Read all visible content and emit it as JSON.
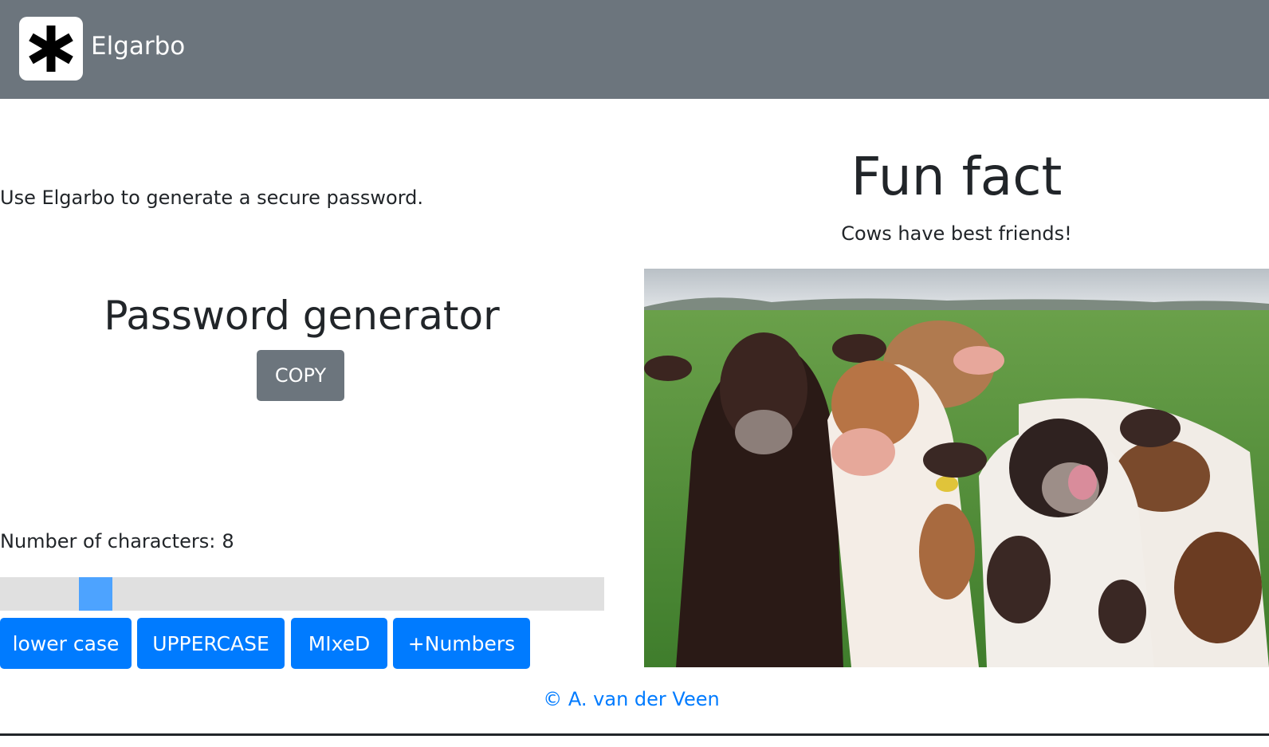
{
  "navbar": {
    "brand": "Elgarbo",
    "logo_icon": "asterisk-icon",
    "background": "#6c757d"
  },
  "intro_text": "Use Elgarbo to generate a secure password.",
  "generator": {
    "title": "Password generator",
    "copy_label": "COPY",
    "length_label": "Number of characters:",
    "length_value": "8",
    "slider": {
      "min": 0,
      "max": 40,
      "value": 8
    },
    "mode_buttons": [
      "lower case",
      "UPPERCASE",
      "MIxeD",
      "+Numbers"
    ]
  },
  "fun_fact": {
    "title": "Fun fact",
    "text": "Cows have best friends!",
    "image_subject": "four cows in a green pasture"
  },
  "footer": {
    "credit": "© A. van der Veen"
  },
  "colors": {
    "primary": "#007bff",
    "secondary": "#6c757d",
    "slider_track": "#e0e0e0",
    "slider_thumb": "#4da3ff"
  }
}
